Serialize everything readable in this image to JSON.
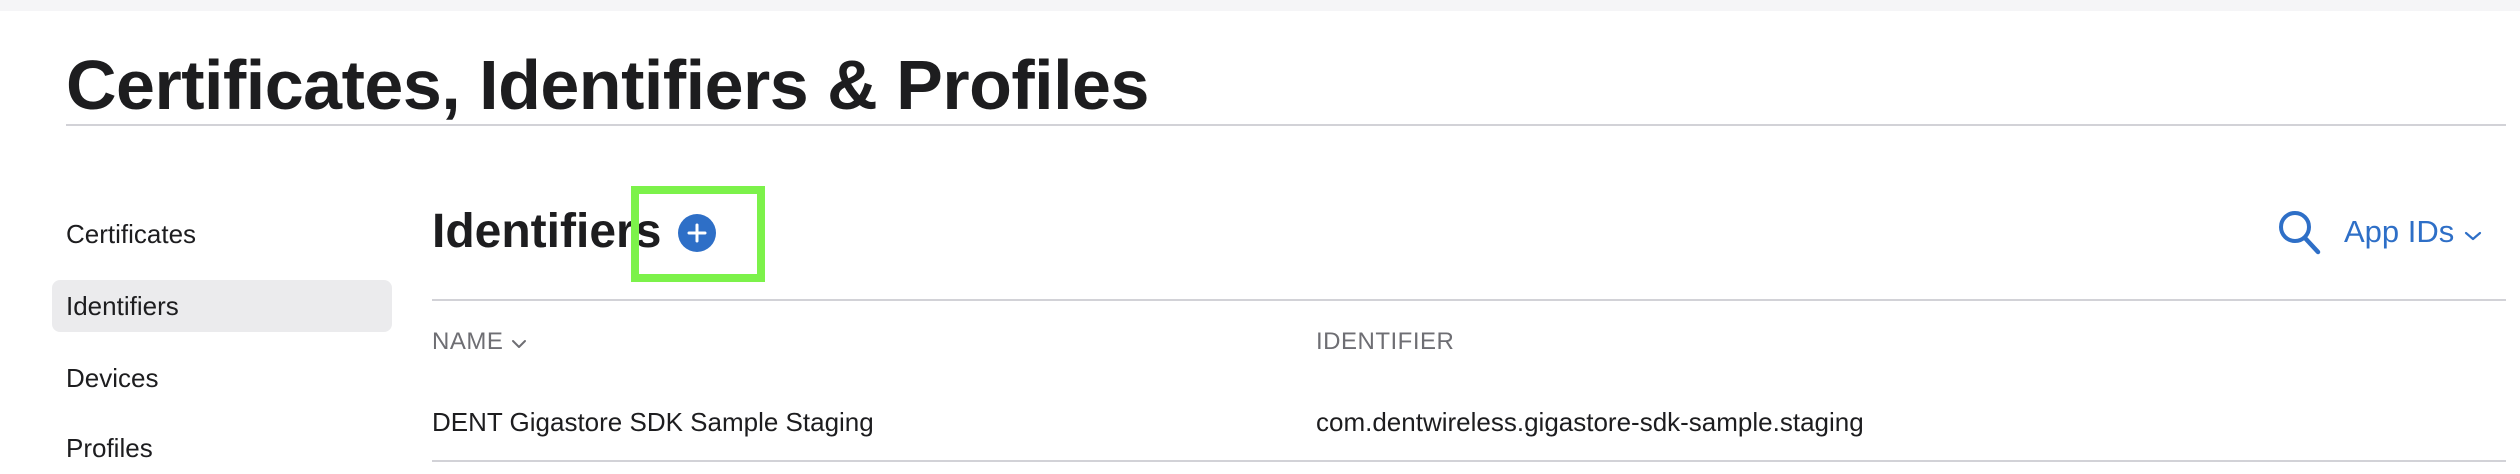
{
  "header": {
    "title": "Certificates, Identifiers & Profiles"
  },
  "sidebar": {
    "items": [
      {
        "label": "Certificates",
        "active": false
      },
      {
        "label": "Identifiers",
        "active": true
      },
      {
        "label": "Devices",
        "active": false
      },
      {
        "label": "Profiles",
        "active": false
      }
    ]
  },
  "main": {
    "section_title": "Identifiers",
    "add_button_icon": "plus-circle-icon",
    "search_icon": "search-icon",
    "filter": {
      "selected": "App IDs",
      "icon": "chevron-down-icon"
    },
    "table": {
      "columns": [
        {
          "label": "NAME",
          "sortable": true
        },
        {
          "label": "IDENTIFIER",
          "sortable": false
        }
      ],
      "rows": [
        {
          "name": "DENT Gigastore SDK Sample Staging",
          "identifier": "com.dentwireless.gigastore-sdk-sample.staging"
        }
      ]
    }
  },
  "colors": {
    "accent": "#2e6fc7",
    "highlight": "#7cf24a",
    "text": "#1d1d1f",
    "muted": "#6e6e73",
    "active_bg": "#ebebed",
    "rule": "#d2d2d7"
  }
}
